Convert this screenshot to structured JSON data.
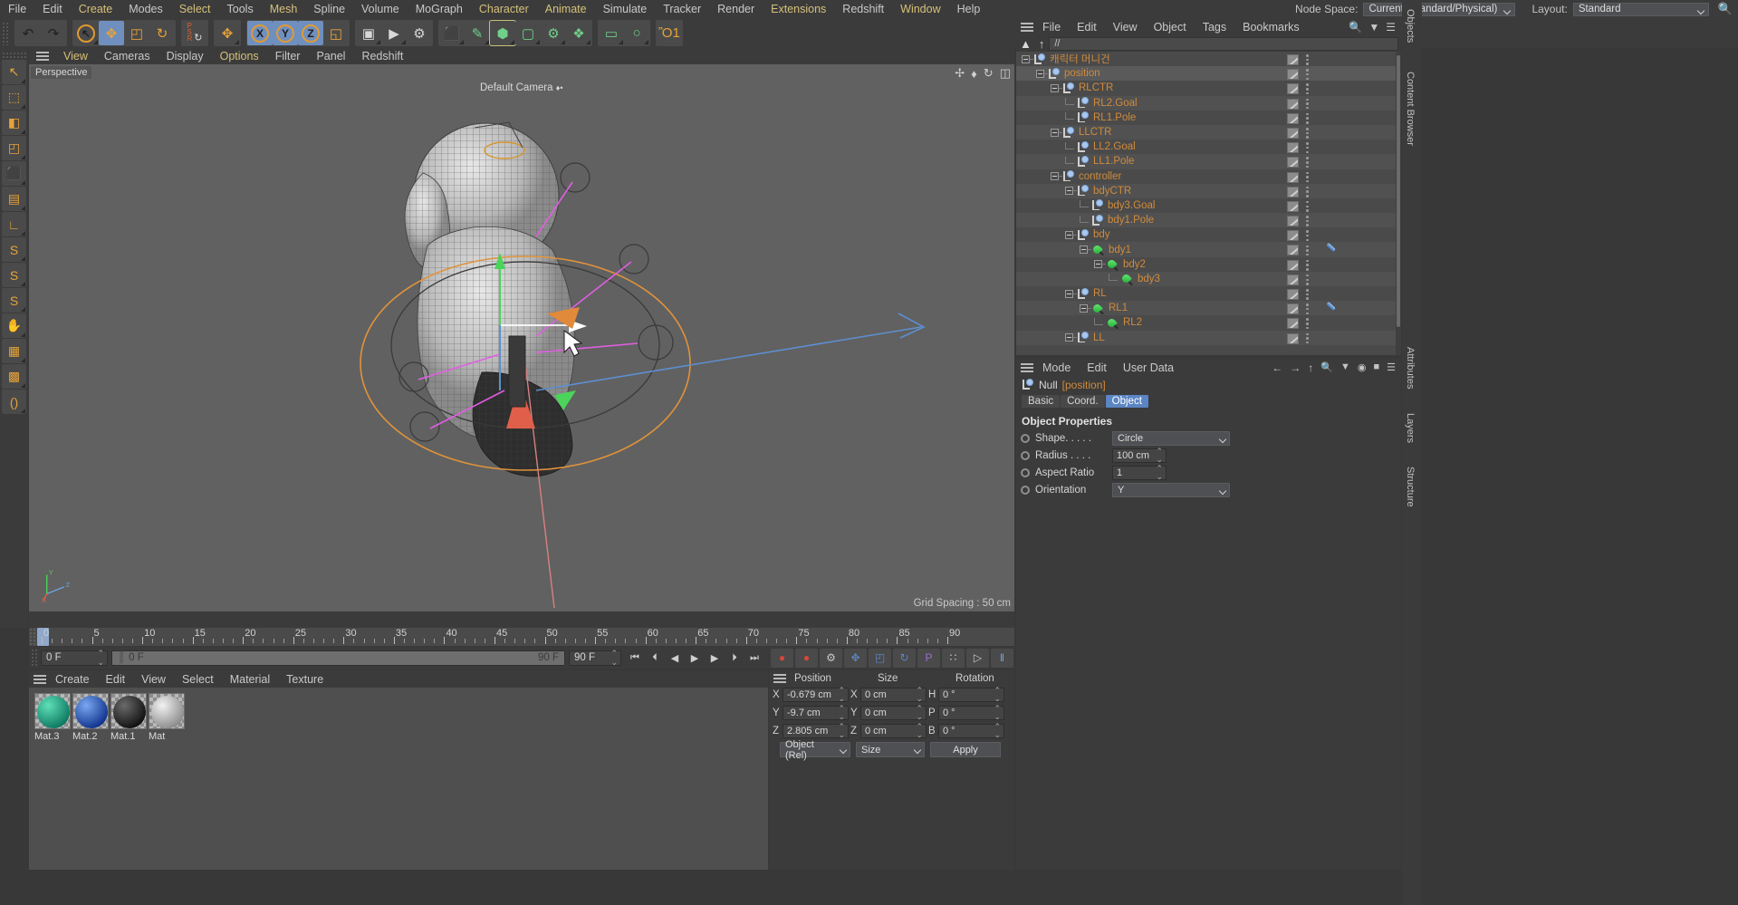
{
  "menubar": {
    "items": [
      {
        "label": "File",
        "accent": false
      },
      {
        "label": "Edit",
        "accent": false
      },
      {
        "label": "Create",
        "accent": true
      },
      {
        "label": "Modes",
        "accent": false
      },
      {
        "label": "Select",
        "accent": true
      },
      {
        "label": "Tools",
        "accent": false
      },
      {
        "label": "Mesh",
        "accent": true
      },
      {
        "label": "Spline",
        "accent": false
      },
      {
        "label": "Volume",
        "accent": false
      },
      {
        "label": "MoGraph",
        "accent": false
      },
      {
        "label": "Character",
        "accent": true
      },
      {
        "label": "Animate",
        "accent": true
      },
      {
        "label": "Simulate",
        "accent": false
      },
      {
        "label": "Tracker",
        "accent": false
      },
      {
        "label": "Render",
        "accent": false
      },
      {
        "label": "Extensions",
        "accent": true
      },
      {
        "label": "Redshift",
        "accent": false
      },
      {
        "label": "Window",
        "accent": true
      },
      {
        "label": "Help",
        "accent": false
      }
    ],
    "node_space_label": "Node Space:",
    "node_space_value": "Current (Standard/Physical)",
    "layout_label": "Layout:",
    "layout_value": "Standard",
    "search_icon": "search-icon"
  },
  "toolbar": {
    "groups": [
      {
        "name": "history",
        "buttons": [
          {
            "name": "undo-button",
            "glyph": "↶",
            "selected": false,
            "corner": false
          },
          {
            "name": "redo-button",
            "glyph": "↷",
            "selected": false,
            "corner": false
          }
        ]
      },
      {
        "name": "transform",
        "buttons": [
          {
            "name": "select-tool",
            "glyph": "↖",
            "selected": false,
            "corner": true,
            "ring": true
          },
          {
            "name": "move-tool",
            "glyph": "✥",
            "selected": true,
            "corner": false
          },
          {
            "name": "scale-tool",
            "glyph": "◰",
            "selected": false,
            "corner": false
          },
          {
            "name": "rotate-tool",
            "glyph": "↻",
            "selected": false,
            "corner": false
          }
        ]
      },
      {
        "name": "psr",
        "buttons": [
          {
            "name": "psr-tool",
            "glyph": "PSR",
            "selected": false,
            "corner": false
          }
        ]
      },
      {
        "name": "axis-move",
        "buttons": [
          {
            "name": "move-axis-tool",
            "glyph": "✥",
            "selected": false,
            "corner": true
          }
        ]
      },
      {
        "name": "axis-lock",
        "buttons": [
          {
            "name": "lock-x-axis",
            "glyph": "X",
            "selected": true,
            "corner": false,
            "ring": true
          },
          {
            "name": "lock-y-axis",
            "glyph": "Y",
            "selected": true,
            "corner": false,
            "ring": true
          },
          {
            "name": "lock-z-axis",
            "glyph": "Z",
            "selected": true,
            "corner": false,
            "ring": true
          },
          {
            "name": "world-object-coord",
            "glyph": "◱",
            "selected": false,
            "corner": false
          }
        ]
      },
      {
        "name": "render",
        "buttons": [
          {
            "name": "render-view-button",
            "glyph": "▣",
            "selected": false,
            "corner": true
          },
          {
            "name": "render-to-picture-viewer-button",
            "glyph": "▶",
            "selected": false,
            "corner": true
          },
          {
            "name": "render-settings-button",
            "glyph": "⚙",
            "selected": false,
            "corner": false
          }
        ]
      },
      {
        "name": "primitives",
        "buttons": [
          {
            "name": "cube-primitive-button",
            "glyph": "⬛",
            "selected": false,
            "corner": true
          },
          {
            "name": "spline-pen-button",
            "glyph": "✎",
            "selected": false,
            "corner": true
          },
          {
            "name": "nurbs-generator-button",
            "glyph": "⬢",
            "selected": false,
            "corner": true,
            "highlight": true
          },
          {
            "name": "array-modeling-button",
            "glyph": "▢",
            "selected": false,
            "corner": true
          },
          {
            "name": "deformer-button",
            "glyph": "⚙",
            "selected": false,
            "corner": true
          },
          {
            "name": "environment-button",
            "glyph": "❖",
            "selected": false,
            "corner": true
          }
        ]
      },
      {
        "name": "scene",
        "buttons": [
          {
            "name": "camera-button",
            "glyph": "▭",
            "selected": false,
            "corner": true
          },
          {
            "name": "light-button",
            "glyph": "○",
            "selected": false,
            "corner": true
          }
        ]
      },
      {
        "name": "tips",
        "buttons": [
          {
            "name": "bulb-icon",
            "glyph": "Ὂ1",
            "selected": false,
            "corner": false
          }
        ]
      }
    ]
  },
  "left_palette": {
    "buttons": [
      {
        "name": "live-selection-tool",
        "glyph": "↖"
      },
      {
        "name": "point-mode-tool",
        "glyph": "⬚"
      },
      {
        "name": "edge-mode-tool",
        "glyph": "◧"
      },
      {
        "name": "polygon-mode-tool",
        "glyph": "◰"
      },
      {
        "name": "model-mode-tool",
        "glyph": "⬛"
      },
      {
        "name": "texture-mode-tool",
        "glyph": "▤"
      },
      {
        "name": "axis-mode-tool",
        "glyph": "∟"
      },
      {
        "name": "snap-s1-tool",
        "glyph": "S"
      },
      {
        "name": "snap-s2-tool",
        "glyph": "S"
      },
      {
        "name": "snap-s3-tool",
        "glyph": "S"
      },
      {
        "name": "workplane-tool",
        "glyph": "✋"
      },
      {
        "name": "subdivision-tool",
        "glyph": "▦"
      },
      {
        "name": "deform-grid-tool",
        "glyph": "▩"
      },
      {
        "name": "xpresso-tool",
        "glyph": "()"
      }
    ]
  },
  "viewport": {
    "menu": [
      {
        "label": "View",
        "accent": true
      },
      {
        "label": "Cameras",
        "accent": false
      },
      {
        "label": "Display",
        "accent": false
      },
      {
        "label": "Options",
        "accent": true
      },
      {
        "label": "Filter",
        "accent": false
      },
      {
        "label": "Panel",
        "accent": false
      },
      {
        "label": "Redshift",
        "accent": false
      }
    ],
    "perspective_label": "Perspective",
    "camera_label": "Default Camera",
    "grid_label": "Grid Spacing : 50 cm",
    "axis_x": "X",
    "axis_y": "Y",
    "axis_z": "Z",
    "corner_icons": [
      "pan-view-icon",
      "zoom-view-icon",
      "rotate-view-icon",
      "maximize-view-icon"
    ]
  },
  "timeline": {
    "labels": [
      "0",
      "5",
      "10",
      "15",
      "20",
      "25",
      "30",
      "35",
      "40",
      "45",
      "50",
      "55",
      "60",
      "65",
      "70",
      "75",
      "80",
      "85",
      "90"
    ],
    "values": [
      0,
      5,
      10,
      15,
      20,
      25,
      30,
      35,
      40,
      45,
      50,
      55,
      60,
      65,
      70,
      75,
      80,
      85,
      90
    ],
    "current_frame_badge": "0 F",
    "start_field": "0 F",
    "bar_label": "0 F",
    "preview_end": "90 F",
    "end_field": "90 F",
    "transport_buttons": [
      {
        "name": "go-to-start-button",
        "glyph": "⏮"
      },
      {
        "name": "previous-key-button",
        "glyph": "⏴"
      },
      {
        "name": "step-back-button",
        "glyph": "◀"
      },
      {
        "name": "play-button",
        "glyph": "▶"
      },
      {
        "name": "step-forward-button",
        "glyph": "▶"
      },
      {
        "name": "next-key-button",
        "glyph": "⏵"
      },
      {
        "name": "go-to-end-button",
        "glyph": "⏭"
      }
    ],
    "record_buttons": [
      {
        "name": "record-active-objects-button",
        "glyph": "●",
        "color": "#d04a3a"
      },
      {
        "name": "autokeying-button",
        "glyph": "●",
        "color": "#d04a3a"
      },
      {
        "name": "keyframe-selection-button",
        "glyph": "⚙",
        "color": "#c9c9c9"
      },
      {
        "name": "position-key-button",
        "glyph": "✥",
        "color": "#5b85c4"
      },
      {
        "name": "scale-key-button",
        "glyph": "◰",
        "color": "#5b85c4"
      },
      {
        "name": "rotation-key-button",
        "glyph": "↻",
        "color": "#5b85c4"
      },
      {
        "name": "parameter-key-button",
        "glyph": "P",
        "color": "#9b6fd0"
      },
      {
        "name": "point-level-animation-button",
        "glyph": "∷",
        "color": "#c9c9c9"
      },
      {
        "name": "toggle-animation-mode-button",
        "glyph": "▷",
        "color": "#c9c9c9"
      },
      {
        "name": "timeline-settings-button",
        "glyph": "‖",
        "color": "#7fa5d8"
      }
    ]
  },
  "material_manager": {
    "menu": [
      "Create",
      "Edit",
      "View",
      "Select",
      "Material",
      "Texture"
    ],
    "materials": [
      {
        "name": "Mat.3",
        "color_a": "#5fe0b8",
        "color_b": "#0e7a62"
      },
      {
        "name": "Mat.2",
        "color_a": "#7aa8f0",
        "color_b": "#11348f"
      },
      {
        "name": "Mat.1",
        "color_a": "#6a6a6a",
        "color_b": "#121212"
      },
      {
        "name": "Mat",
        "color_a": "#f2f2f2",
        "color_b": "#8e8e8e"
      }
    ]
  },
  "coordinate_manager": {
    "columns": [
      "Position",
      "Size",
      "Rotation"
    ],
    "position": [
      {
        "axis": "X",
        "value": "-0.679 cm"
      },
      {
        "axis": "Y",
        "value": "-9.7 cm"
      },
      {
        "axis": "Z",
        "value": "2.805 cm"
      }
    ],
    "size": [
      {
        "axis": "X",
        "value": "0 cm"
      },
      {
        "axis": "Y",
        "value": "0 cm"
      },
      {
        "axis": "Z",
        "value": "0 cm"
      }
    ],
    "rotation": [
      {
        "axis": "H",
        "value": "0 °"
      },
      {
        "axis": "P",
        "value": "0 °"
      },
      {
        "axis": "B",
        "value": "0 °"
      }
    ],
    "mode_combo": "Object (Rel)",
    "size_combo": "Size",
    "apply_button": "Apply"
  },
  "object_manager": {
    "menu": [
      "File",
      "Edit",
      "View",
      "Object",
      "Tags",
      "Bookmarks"
    ],
    "path_value": "//",
    "home_icon": "home-icon",
    "up_icon": "up-arrow-icon",
    "toolbar_icons": [
      "search-icon",
      "filter-icon",
      "list-icon"
    ],
    "rows": [
      {
        "label": "캐릭터 머니건",
        "depth": 0,
        "icon": "null-icon",
        "expander": true,
        "selected": false,
        "weight_tag": false
      },
      {
        "label": "position",
        "depth": 1,
        "icon": "null-icon",
        "expander": true,
        "selected": true,
        "weight_tag": false
      },
      {
        "label": "RLCTR",
        "depth": 2,
        "icon": "null-icon",
        "expander": true,
        "selected": false,
        "weight_tag": false
      },
      {
        "label": "RL2.Goal",
        "depth": 3,
        "icon": "null-icon",
        "expander": false,
        "selected": false,
        "weight_tag": false
      },
      {
        "label": "RL1.Pole",
        "depth": 3,
        "icon": "null-icon",
        "expander": false,
        "selected": false,
        "weight_tag": false
      },
      {
        "label": "LLCTR",
        "depth": 2,
        "icon": "null-icon",
        "expander": true,
        "selected": false,
        "weight_tag": false
      },
      {
        "label": "LL2.Goal",
        "depth": 3,
        "icon": "null-icon",
        "expander": false,
        "selected": false,
        "weight_tag": false
      },
      {
        "label": "LL1.Pole",
        "depth": 3,
        "icon": "null-icon",
        "expander": false,
        "selected": false,
        "weight_tag": false
      },
      {
        "label": "controller",
        "depth": 2,
        "icon": "null-icon",
        "expander": true,
        "selected": false,
        "weight_tag": false
      },
      {
        "label": "bdyCTR",
        "depth": 3,
        "icon": "null-icon",
        "expander": true,
        "selected": false,
        "weight_tag": false
      },
      {
        "label": "bdy3.Goal",
        "depth": 4,
        "icon": "null-icon",
        "expander": false,
        "selected": false,
        "weight_tag": false
      },
      {
        "label": "bdy1.Pole",
        "depth": 4,
        "icon": "null-icon",
        "expander": false,
        "selected": false,
        "weight_tag": false
      },
      {
        "label": "bdy",
        "depth": 3,
        "icon": "null-icon",
        "expander": true,
        "selected": false,
        "weight_tag": false
      },
      {
        "label": "bdy1",
        "depth": 4,
        "icon": "joint-icon",
        "expander": true,
        "selected": false,
        "weight_tag": true
      },
      {
        "label": "bdy2",
        "depth": 5,
        "icon": "joint-icon",
        "expander": true,
        "selected": false,
        "weight_tag": false
      },
      {
        "label": "bdy3",
        "depth": 6,
        "icon": "joint-icon",
        "expander": false,
        "selected": false,
        "weight_tag": false
      },
      {
        "label": "RL",
        "depth": 3,
        "icon": "null-icon",
        "expander": true,
        "selected": false,
        "weight_tag": false
      },
      {
        "label": "RL1",
        "depth": 4,
        "icon": "joint-icon",
        "expander": true,
        "selected": false,
        "weight_tag": true
      },
      {
        "label": "RL2",
        "depth": 5,
        "icon": "joint-icon",
        "expander": false,
        "selected": false,
        "weight_tag": false
      },
      {
        "label": "LL",
        "depth": 3,
        "icon": "null-icon",
        "expander": true,
        "selected": false,
        "weight_tag": false
      }
    ]
  },
  "attribute_manager": {
    "menu": [
      "Mode",
      "Edit",
      "User Data"
    ],
    "nav_icons": [
      "back-arrow-icon",
      "forward-arrow-icon",
      "up-arrow-icon",
      "search-icon",
      "filter-icon",
      "pin-icon",
      "lock-icon",
      "menu-icon"
    ],
    "object_type": "Null",
    "object_name": "[position]",
    "tabs": [
      {
        "label": "Basic",
        "active": false
      },
      {
        "label": "Coord.",
        "active": false
      },
      {
        "label": "Object",
        "active": true
      }
    ],
    "section_title": "Object Properties",
    "properties": [
      {
        "label": "Shape. . . . .",
        "type": "combo",
        "value": "Circle"
      },
      {
        "label": "Radius . . . .",
        "type": "number",
        "value": "100 cm"
      },
      {
        "label": "Aspect Ratio",
        "type": "number",
        "value": "1"
      },
      {
        "label": "Orientation",
        "type": "combo",
        "value": "Y"
      }
    ]
  },
  "right_strip": {
    "tabs": [
      "Objects",
      "Content Browser",
      "Attributes",
      "Layers",
      "Structure"
    ]
  },
  "colors": {
    "panel_bg": "#3b3b3b",
    "list_bg": "#4a4a4a",
    "viewport_bg": "#616161",
    "accent_orange": "#d08b3c",
    "accent_blue": "#5b85c4",
    "menu_gold": "#d6c07a"
  }
}
